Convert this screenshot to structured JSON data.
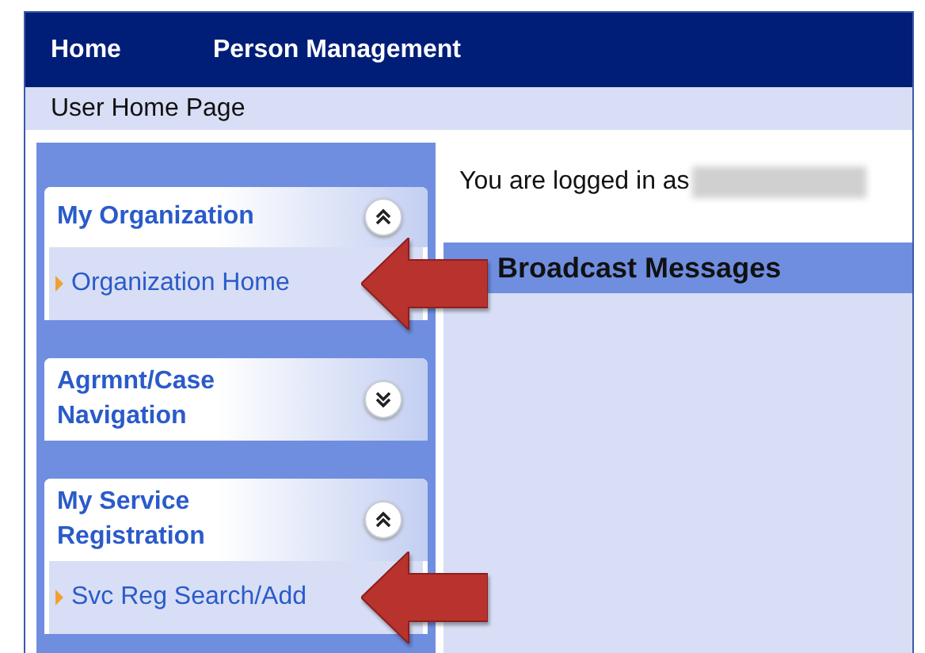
{
  "nav": {
    "items": [
      {
        "label": "Home"
      },
      {
        "label": "Person Management"
      }
    ]
  },
  "breadcrumb": "User Home Page",
  "sidebar": {
    "panels": [
      {
        "title": "My Organization",
        "expanded": true,
        "items": [
          {
            "label": "Organization Home",
            "annotated": true
          }
        ]
      },
      {
        "title": "Agrmnt/Case Navigation",
        "expanded": false
      },
      {
        "title": "My Service Registration",
        "expanded": true,
        "items": [
          {
            "label": "Svc Reg Search/Add",
            "annotated": true
          }
        ]
      }
    ]
  },
  "main": {
    "login_text": "You are logged in as",
    "broadcast_title": "Broadcast Messages"
  }
}
